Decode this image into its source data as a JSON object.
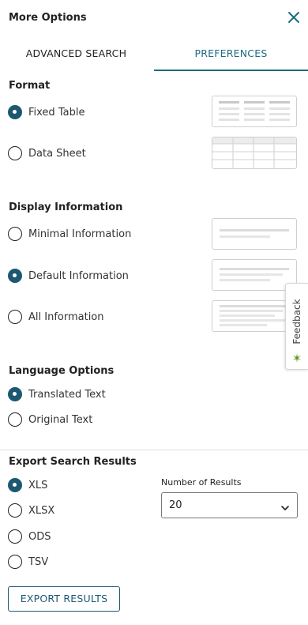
{
  "header": {
    "title": "More Options",
    "close_icon": "close-icon"
  },
  "tabs": [
    {
      "label": "ADVANCED SEARCH",
      "active": false
    },
    {
      "label": "PREFERENCES",
      "active": true
    }
  ],
  "format": {
    "title": "Format",
    "options": [
      {
        "label": "Fixed Table",
        "selected": true,
        "icon": "fixed-table-preview-icon"
      },
      {
        "label": "Data Sheet",
        "selected": false,
        "icon": "data-sheet-preview-icon"
      }
    ]
  },
  "display": {
    "title": "Display Information",
    "options": [
      {
        "label": "Minimal Information",
        "selected": false,
        "icon": "minimal-info-preview-icon"
      },
      {
        "label": "Default Information",
        "selected": true,
        "icon": "default-info-preview-icon"
      },
      {
        "label": "All Information",
        "selected": false,
        "icon": "all-info-preview-icon"
      }
    ]
  },
  "language": {
    "title": "Language Options",
    "options": [
      {
        "label": "Translated Text",
        "selected": true
      },
      {
        "label": "Original Text",
        "selected": false
      }
    ]
  },
  "export": {
    "title": "Export Search Results",
    "options": [
      {
        "label": "XLS",
        "selected": true
      },
      {
        "label": "XLSX",
        "selected": false
      },
      {
        "label": "ODS",
        "selected": false
      },
      {
        "label": "TSV",
        "selected": false
      }
    ],
    "number_of_results_label": "Number of Results",
    "number_of_results_value": "20",
    "button_label": "EXPORT RESULTS"
  },
  "feedback": {
    "label": "Feedback"
  },
  "colors": {
    "accent": "#1d6b82",
    "radio_selected": "#1d5873",
    "divider": "#dcdcdc"
  }
}
